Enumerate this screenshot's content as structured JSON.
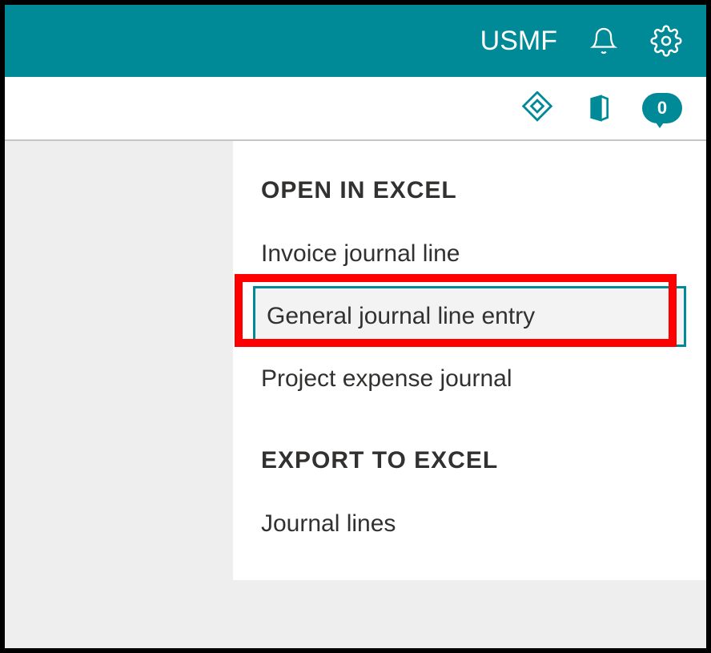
{
  "header": {
    "company": "USMF"
  },
  "badge": {
    "count": "0"
  },
  "menu": {
    "section1_header": "OPEN IN EXCEL",
    "section1_items": [
      "Invoice journal line",
      "General journal line entry",
      "Project expense journal"
    ],
    "section2_header": "EXPORT TO EXCEL",
    "section2_items": [
      "Journal lines"
    ]
  }
}
